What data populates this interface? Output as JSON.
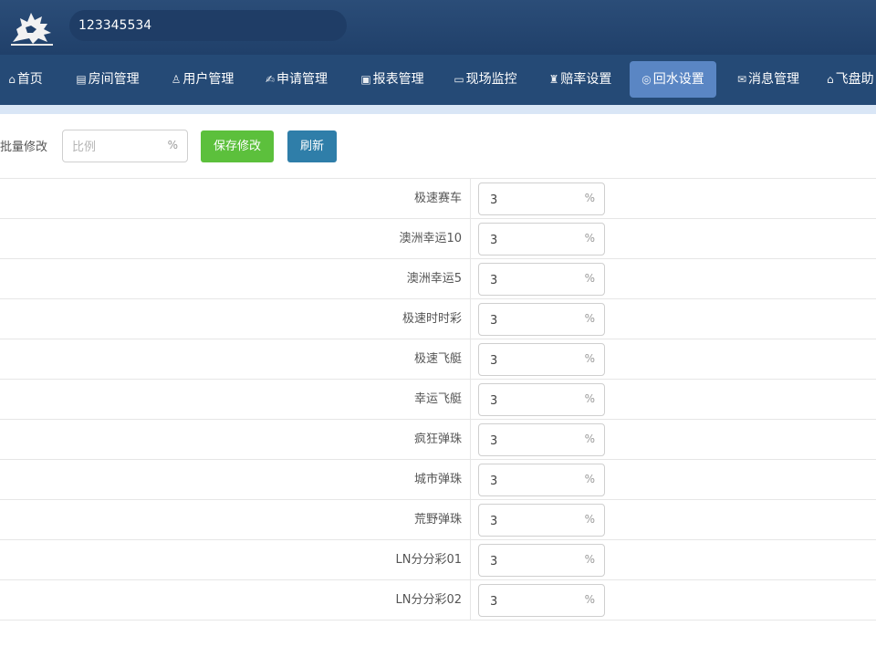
{
  "header": {
    "account": "123345534",
    "logo_icon": "qilin-logo"
  },
  "nav": {
    "items": [
      {
        "icon": "⌂",
        "label": "首页"
      },
      {
        "icon": "▤",
        "label": "房间管理"
      },
      {
        "icon": "♙",
        "label": "用户管理"
      },
      {
        "icon": "✍",
        "label": "申请管理"
      },
      {
        "icon": "▣",
        "label": "报表管理"
      },
      {
        "icon": "▭",
        "label": "现场监控"
      },
      {
        "icon": "♜",
        "label": "赔率设置"
      },
      {
        "icon": "◎",
        "label": "回水设置"
      },
      {
        "icon": "✉",
        "label": "消息管理"
      },
      {
        "icon": "⌂",
        "label": "飞盘助"
      }
    ],
    "active_index": 7
  },
  "toolbar": {
    "batch_label": "批量修改",
    "batch_placeholder": "比例",
    "pct_symbol": "%",
    "save_label": "保存修改",
    "refresh_label": "刷新"
  },
  "games": [
    {
      "name": "极速赛车",
      "value": "3"
    },
    {
      "name": "澳洲幸运10",
      "value": "3"
    },
    {
      "name": "澳洲幸运5",
      "value": "3"
    },
    {
      "name": "极速时时彩",
      "value": "3"
    },
    {
      "name": "极速飞艇",
      "value": "3"
    },
    {
      "name": "幸运飞艇",
      "value": "3"
    },
    {
      "name": "疯狂弹珠",
      "value": "3"
    },
    {
      "name": "城市弹珠",
      "value": "3"
    },
    {
      "name": "荒野弹珠",
      "value": "3"
    },
    {
      "name": "LN分分彩01",
      "value": "3"
    },
    {
      "name": "LN分分彩02",
      "value": "3"
    }
  ],
  "colors": {
    "header_bg": "#254a76",
    "active_nav": "#5a86c4",
    "save_button": "#5cc03c",
    "refresh_button": "#2f7ea9"
  }
}
